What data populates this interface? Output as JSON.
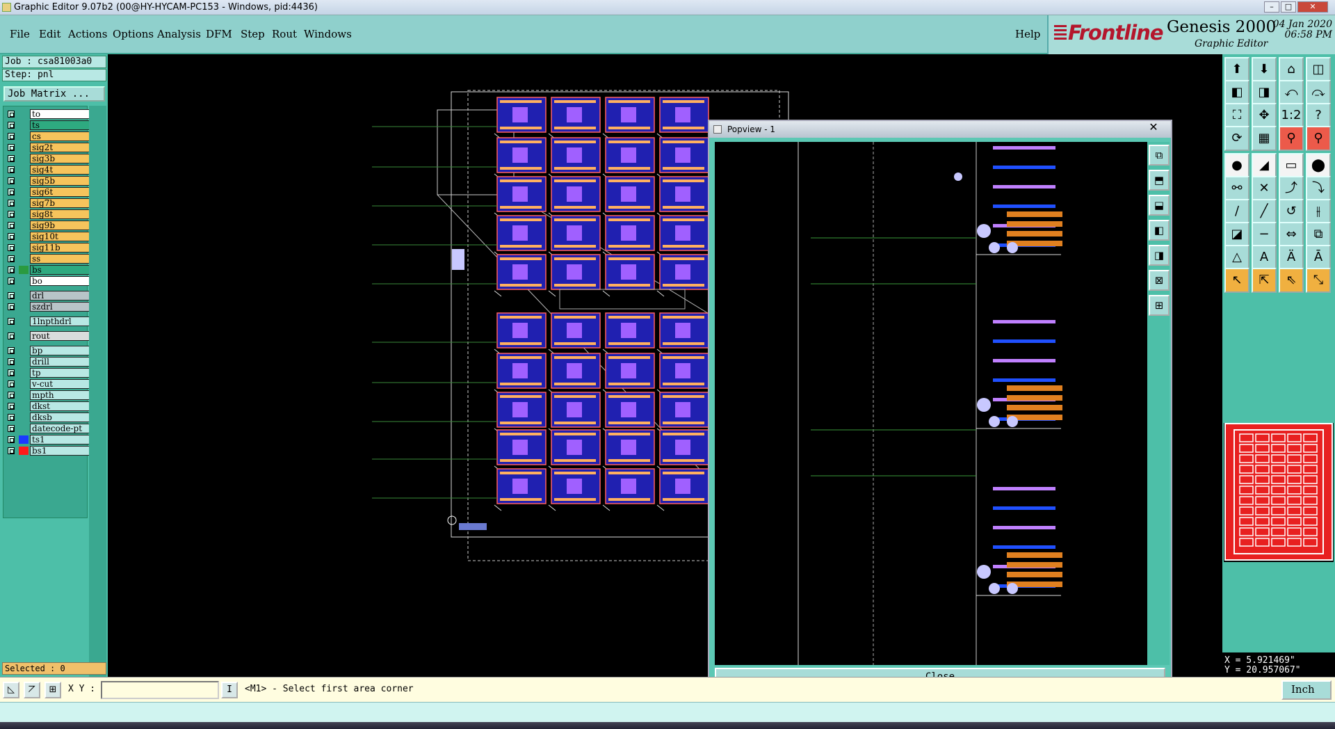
{
  "window": {
    "title": "Graphic Editor 9.07b2 (00@HY-HYCAM-PC153 - Windows, pid:4436)",
    "controls": [
      "–",
      "□",
      "✕"
    ]
  },
  "menu": [
    "File",
    "Edit",
    "Actions",
    "Options",
    "Analysis",
    "DFM",
    "Step",
    "Rout",
    "Windows"
  ],
  "help_label": "Help",
  "brand": {
    "logo": "Frontline",
    "product": "Genesis 2000",
    "subtitle": "Graphic Editor",
    "date": "04 Jan 2020",
    "time": "06:58 PM",
    "logo_color": "#b4162c"
  },
  "job": {
    "job_line": "Job : csa81003a0",
    "step_line": "Step: pnl",
    "matrix_button": "Job Matrix ..."
  },
  "layers": [
    {
      "name": "to",
      "color": "#ffffff",
      "swatch": ""
    },
    {
      "name": "ts",
      "color": "#2eaa80",
      "swatch": ""
    },
    {
      "name": "cs",
      "color": "#f6c45c",
      "swatch": ""
    },
    {
      "name": "sig2t",
      "color": "#f6c45c",
      "swatch": ""
    },
    {
      "name": "sig3b",
      "color": "#f6c45c",
      "swatch": ""
    },
    {
      "name": "sig4t",
      "color": "#f6c45c",
      "swatch": ""
    },
    {
      "name": "sig5b",
      "color": "#f6c45c",
      "swatch": ""
    },
    {
      "name": "sig6t",
      "color": "#f6c45c",
      "swatch": ""
    },
    {
      "name": "sig7b",
      "color": "#f6c45c",
      "swatch": ""
    },
    {
      "name": "sig8t",
      "color": "#f6c45c",
      "swatch": ""
    },
    {
      "name": "sig9b",
      "color": "#f6c45c",
      "swatch": ""
    },
    {
      "name": "sig10t",
      "color": "#f6c45c",
      "swatch": ""
    },
    {
      "name": "sig11b",
      "color": "#f6c45c",
      "swatch": ""
    },
    {
      "name": "ss",
      "color": "#f6c45c",
      "swatch": ""
    },
    {
      "name": "bs",
      "color": "#2eaa80",
      "swatch": "#2a9a40"
    },
    {
      "name": "bo",
      "color": "#ffffff",
      "swatch": ""
    },
    {
      "name": "drl",
      "color": "#b8c4c8",
      "swatch": ""
    },
    {
      "name": "szdrl",
      "color": "#b8c4c8",
      "swatch": ""
    },
    {
      "name": "1lnpthdrl",
      "color": "#b8e8e4",
      "swatch": ""
    },
    {
      "name": "rout",
      "color": "#d8dcdc",
      "swatch": ""
    },
    {
      "name": "bp",
      "color": "#b8e8e4",
      "swatch": ""
    },
    {
      "name": "drill",
      "color": "#b8e8e4",
      "swatch": ""
    },
    {
      "name": "tp",
      "color": "#b8e8e4",
      "swatch": ""
    },
    {
      "name": "v-cut",
      "color": "#b8e8e4",
      "swatch": ""
    },
    {
      "name": "mpth",
      "color": "#b8e8e4",
      "swatch": ""
    },
    {
      "name": "dkst",
      "color": "#b8e8e4",
      "swatch": ""
    },
    {
      "name": "dksb",
      "color": "#b8e8e4",
      "swatch": ""
    },
    {
      "name": "datecode-pt",
      "color": "#b8e8e4",
      "swatch": ""
    },
    {
      "name": "ts1",
      "color": "#b8e8e4",
      "swatch": "#1a3aff"
    },
    {
      "name": "bs1",
      "color": "#b8e8e4",
      "swatch": "#ff1a1a"
    }
  ],
  "selected": "Selected : 0",
  "popview": {
    "title": "Popview - 1",
    "close_label": "Close",
    "close_x": "✕"
  },
  "coords": {
    "x": "X = 5.921469\"",
    "y": "Y = 20.957067\""
  },
  "bottom": {
    "xy_label": "X Y :",
    "xy_value": "",
    "prompt_icon": "I",
    "prompt": "<M1> - Select first area corner",
    "unit": "Inch"
  }
}
